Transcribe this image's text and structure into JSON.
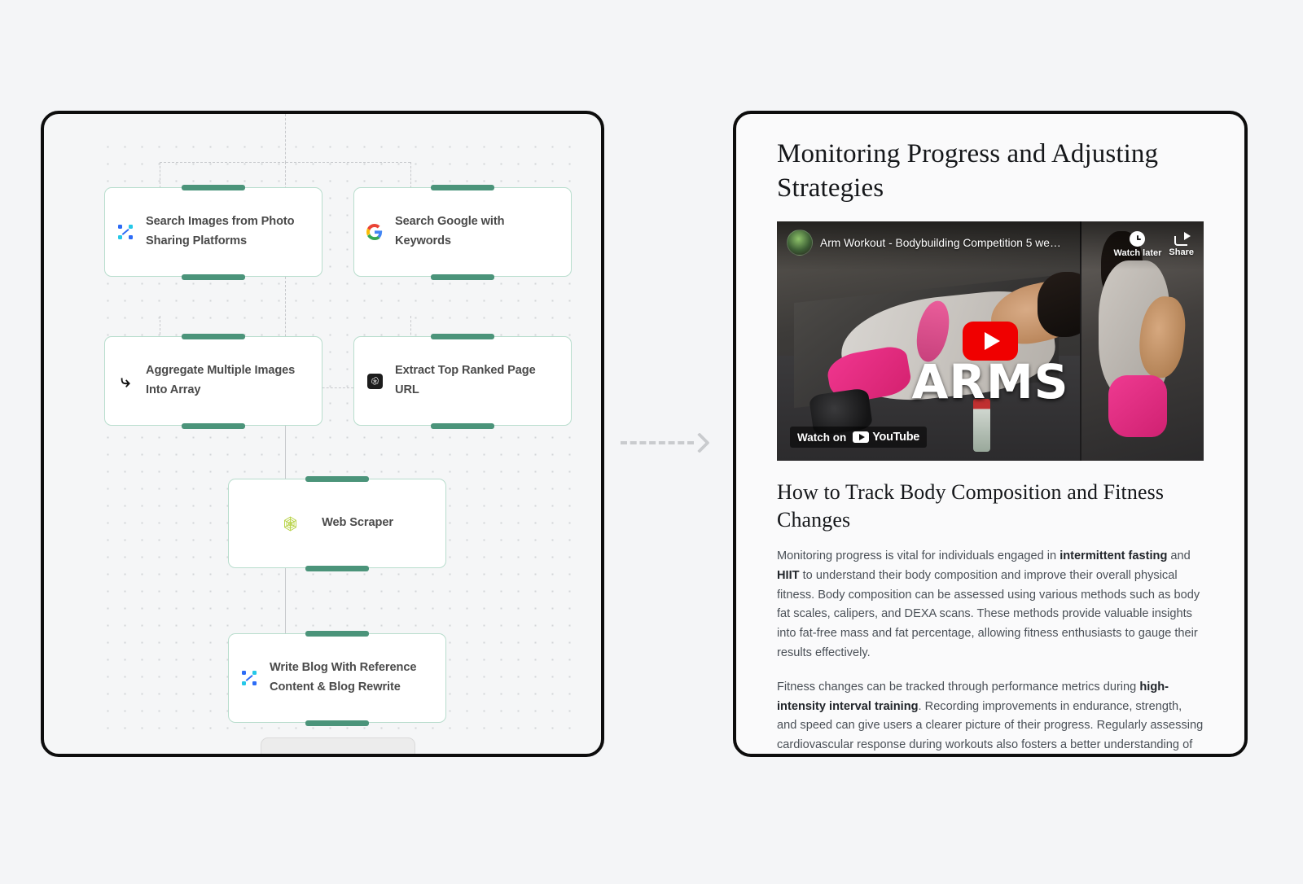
{
  "flow": {
    "nodes": [
      {
        "id": "search-images",
        "label": "Search Images from Photo Sharing Platforms",
        "icon": "nodes-icon"
      },
      {
        "id": "search-google",
        "label": "Search Google with Keywords",
        "icon": "google-icon"
      },
      {
        "id": "aggregate-images",
        "label": "Aggregate Multiple Images Into Array",
        "icon": "curved-arrow-icon"
      },
      {
        "id": "extract-url",
        "label": "Extract Top Ranked Page URL",
        "icon": "openai-icon"
      },
      {
        "id": "web-scraper",
        "label": "Web Scraper",
        "icon": "spiderweb-icon"
      },
      {
        "id": "write-blog",
        "label": "Write Blog With Reference Content & Blog Rewrite",
        "icon": "nodes-icon"
      }
    ],
    "colors": {
      "node_border": "#b8ddcd",
      "handle": "#4b947a",
      "canvas_dot": "#d3d5d8",
      "edge": "#c7c9cc"
    }
  },
  "transition": {
    "arrow": "dashed-right-arrow-icon",
    "color": "#c9cbce"
  },
  "article": {
    "title": "Monitoring Progress and Adjusting Strategies",
    "video": {
      "title": "Arm Workout - Bodybuilding Competition 5 we…",
      "watch_later_label": "Watch later",
      "share_label": "Share",
      "watch_on_label": "Watch on",
      "platform_label": "YouTube",
      "thumbnail_text": "ARMS",
      "play_button": "youtube-play-icon",
      "brand_color": "#f00000"
    },
    "heading2": "How to Track Body Composition and Fitness Changes",
    "paragraphs": [
      {
        "parts": [
          {
            "text": "Monitoring progress is vital for individuals engaged in ",
            "bold": false
          },
          {
            "text": "intermittent fasting",
            "bold": true
          },
          {
            "text": " and ",
            "bold": false
          },
          {
            "text": "HIIT",
            "bold": true
          },
          {
            "text": " to understand their body composition and improve their overall physical fitness. Body composition can be assessed using various methods such as body fat scales, calipers, and DEXA scans. These methods provide valuable insights into fat-free mass and fat percentage, allowing fitness enthusiasts to gauge their results effectively.",
            "bold": false
          }
        ]
      },
      {
        "parts": [
          {
            "text": "Fitness changes can be tracked through performance metrics during ",
            "bold": false
          },
          {
            "text": "high-intensity interval training",
            "bold": true
          },
          {
            "text": ". Recording improvements in endurance, strength, and speed can give users a clearer picture of their progress. Regularly assessing cardiovascular response during workouts also fosters a better understanding of physical condition.",
            "bold": false
          }
        ]
      }
    ]
  }
}
